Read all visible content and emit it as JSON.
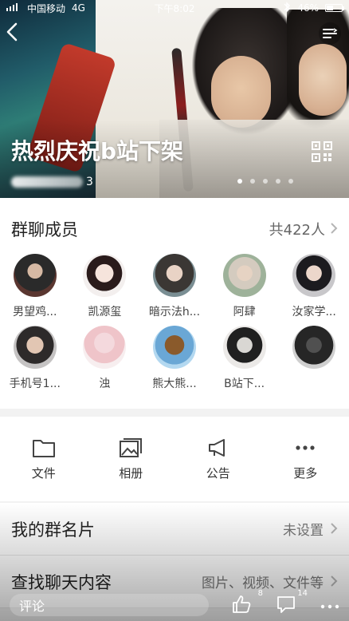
{
  "status_bar": {
    "carrier": "中国移动",
    "network": "4G",
    "time": "下午8:02",
    "battery": "46%",
    "battery_level": 0.46
  },
  "header": {
    "back_icon": "chevron-left-icon",
    "menu_icon": "menu-icon",
    "group_title": "热烈庆祝b站下架",
    "group_id_suffix": "3",
    "qr_icon": "qr-code-icon"
  },
  "members": {
    "title": "群聊成员",
    "count": "共422人",
    "list": [
      {
        "name": "男望鸡..."
      },
      {
        "name": "凯源玺"
      },
      {
        "name": "暗示法h..."
      },
      {
        "name": "阿肆"
      },
      {
        "name": "汝家学..."
      },
      {
        "name": "手机号1..."
      },
      {
        "name": "浊"
      },
      {
        "name": "熊大熊..."
      },
      {
        "name": "B站下..."
      },
      {
        "name": ""
      }
    ]
  },
  "actions": [
    {
      "label": "文件",
      "icon": "folder-icon"
    },
    {
      "label": "相册",
      "icon": "album-icon"
    },
    {
      "label": "公告",
      "icon": "megaphone-icon"
    },
    {
      "label": "更多",
      "icon": "more-icon"
    }
  ],
  "settings": [
    {
      "title": "我的群名片",
      "value": "未设置"
    },
    {
      "title": "查找聊天内容",
      "value": "图片、视频、文件等"
    }
  ],
  "comment_bar": {
    "placeholder": "评论",
    "like_count": "8",
    "comment_count": "14"
  }
}
